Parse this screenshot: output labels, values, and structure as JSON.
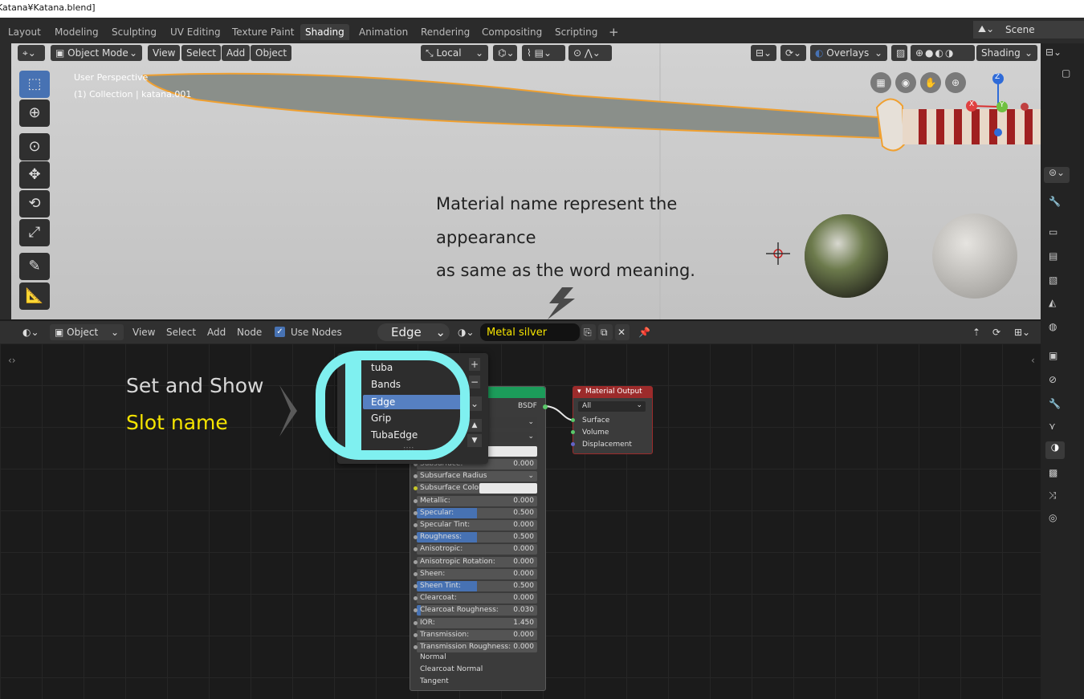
{
  "title_bar": {
    "text": "Katana¥Katana.blend]"
  },
  "workspace_tabs": [
    {
      "label": "Layout"
    },
    {
      "label": "Modeling"
    },
    {
      "label": "Sculpting"
    },
    {
      "label": "UV Editing"
    },
    {
      "label": "Texture Paint"
    },
    {
      "label": "Shading",
      "active": true
    },
    {
      "label": "Animation"
    },
    {
      "label": "Rendering"
    },
    {
      "label": "Compositing"
    },
    {
      "label": "Scripting"
    }
  ],
  "scene": {
    "label": "Scene"
  },
  "viewport": {
    "mode": "Object Mode",
    "menus": [
      "View",
      "Select",
      "Add",
      "Object"
    ],
    "transform_orientation": "Local",
    "overlays_label": "Overlays",
    "shading_label": "Shading",
    "perspective_label": "User Perspective",
    "collection_label": "(1) Collection | katana.001",
    "gizmo_axes": [
      "Z",
      "X",
      "Y"
    ],
    "annotation": [
      "Material name represent the",
      "appearance",
      "as same as the word meaning."
    ]
  },
  "node_editor": {
    "editor_type": "Object",
    "menus": [
      "View",
      "Select",
      "Add",
      "Node"
    ],
    "use_nodes_label": "Use Nodes",
    "slot_selected": "Edge",
    "material_name": "Metal silver",
    "annotation_line1": "Set and Show",
    "annotation_line2": "Slot name",
    "slot_list": [
      "tuba",
      "Bands",
      "Edge",
      "Grip",
      "TubaEdge"
    ],
    "slot_active": "Edge",
    "bsdf": {
      "output_label": "BSDF",
      "rows": [
        {
          "label": "Subsurface:",
          "value": "0.000",
          "fill": 0
        },
        {
          "label": "Subsurface Radius",
          "value": "",
          "fill": 0,
          "dropdown": true
        },
        {
          "label": "Subsurface Color",
          "value": "",
          "fill": 0,
          "color": true
        },
        {
          "label": "Metallic:",
          "value": "0.000",
          "fill": 0
        },
        {
          "label": "Specular:",
          "value": "0.500",
          "fill": 0.5
        },
        {
          "label": "Specular Tint:",
          "value": "0.000",
          "fill": 0
        },
        {
          "label": "Roughness:",
          "value": "0.500",
          "fill": 0.5
        },
        {
          "label": "Anisotropic:",
          "value": "0.000",
          "fill": 0
        },
        {
          "label": "Anisotropic Rotation:",
          "value": "0.000",
          "fill": 0
        },
        {
          "label": "Sheen:",
          "value": "0.000",
          "fill": 0
        },
        {
          "label": "Sheen Tint:",
          "value": "0.500",
          "fill": 0.5
        },
        {
          "label": "Clearcoat:",
          "value": "0.000",
          "fill": 0
        },
        {
          "label": "Clearcoat Roughness:",
          "value": "0.030",
          "fill": 0.03
        },
        {
          "label": "IOR:",
          "value": "1.450",
          "fill": 0
        },
        {
          "label": "Transmission:",
          "value": "0.000",
          "fill": 0
        },
        {
          "label": "Transmission Roughness:",
          "value": "0.000",
          "fill": 0
        }
      ],
      "inputs": [
        "Normal",
        "Clearcoat Normal",
        "Tangent"
      ]
    },
    "material_output": {
      "title": "Material Output",
      "target": "All",
      "inputs": [
        "Surface",
        "Volume",
        "Displacement"
      ]
    }
  },
  "colors": {
    "accent": "#4772b3",
    "annotation_yellow": "#f5e400",
    "highlight_cyan": "#7ff0f0",
    "output_red": "#9c2b2b",
    "bsdf_green": "#1c9c5a"
  }
}
